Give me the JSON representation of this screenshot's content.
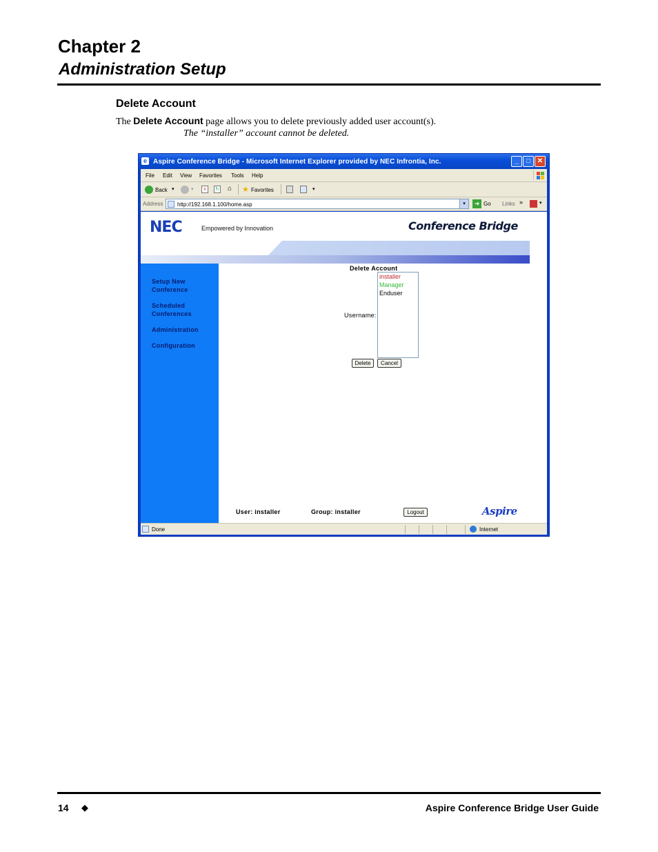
{
  "chapter": {
    "number_label": "Chapter 2",
    "title": "Administration Setup"
  },
  "section": {
    "title": "Delete Account",
    "intro_pre": "The ",
    "intro_bold": "Delete Account",
    "intro_post": " page allows you to delete previously added user account(s).",
    "note": "The “installer” account cannot be deleted."
  },
  "browser": {
    "title": "Aspire Conference Bridge - Microsoft Internet Explorer provided by NEC Infrontia, Inc.",
    "menu": [
      "File",
      "Edit",
      "View",
      "Favorites",
      "Tools",
      "Help"
    ],
    "toolbar": {
      "back": "Back",
      "favorites": "Favorites"
    },
    "address": {
      "label": "Address",
      "url": "http://192.168.1.100/home.asp",
      "go": "Go",
      "links": "Links"
    },
    "status": {
      "left": "Done",
      "zone": "Internet"
    }
  },
  "app": {
    "logo": "NEC",
    "tagline": "Empowered by Innovation",
    "product_title": "Conference Bridge",
    "sidebar": {
      "items": [
        {
          "line1": "Setup New",
          "line2": "Conference"
        },
        {
          "line1": "Scheduled",
          "line2": "Conferences"
        },
        {
          "line1": "Administration",
          "line2": ""
        },
        {
          "line1": "Configuration",
          "line2": ""
        }
      ]
    },
    "form": {
      "title": "Delete Account",
      "username_label": "Username:",
      "users": [
        {
          "name": "installer",
          "color": "#c0282d"
        },
        {
          "name": "Manager",
          "color": "#34b834"
        },
        {
          "name": "Enduser",
          "color": "#000000"
        }
      ],
      "delete_label": "Delete",
      "cancel_label": "Cancel"
    },
    "footer": {
      "user": "User: installer",
      "group": "Group: installer",
      "logout_label": "Logout",
      "brand": "Aspire"
    }
  },
  "page_footer": {
    "page_number": "14",
    "separator": "◆",
    "guide_title": "Aspire Conference Bridge User Guide"
  }
}
